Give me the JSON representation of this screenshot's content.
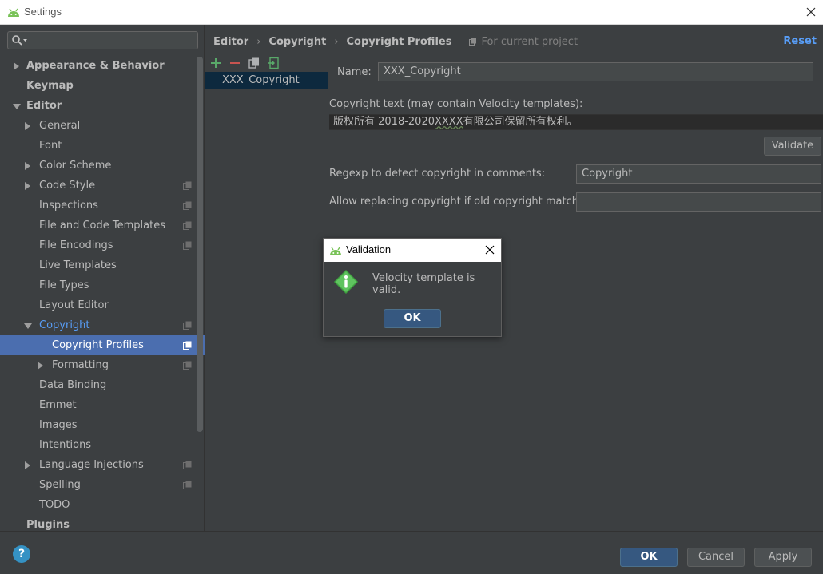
{
  "window": {
    "title": "Settings"
  },
  "sidebar": {
    "search_placeholder": "",
    "items": [
      {
        "label": "Appearance & Behavior",
        "indent": 0,
        "arrow": "right",
        "bold": true,
        "proj": false
      },
      {
        "label": "Keymap",
        "indent": 0,
        "arrow": "none",
        "bold": true,
        "proj": false
      },
      {
        "label": "Editor",
        "indent": 0,
        "arrow": "down",
        "bold": true,
        "proj": false
      },
      {
        "label": "General",
        "indent": 1,
        "arrow": "right",
        "bold": false,
        "proj": false
      },
      {
        "label": "Font",
        "indent": 1,
        "arrow": "none",
        "bold": false,
        "proj": false
      },
      {
        "label": "Color Scheme",
        "indent": 1,
        "arrow": "right",
        "bold": false,
        "proj": false
      },
      {
        "label": "Code Style",
        "indent": 1,
        "arrow": "right",
        "bold": false,
        "proj": true
      },
      {
        "label": "Inspections",
        "indent": 1,
        "arrow": "none",
        "bold": false,
        "proj": true
      },
      {
        "label": "File and Code Templates",
        "indent": 1,
        "arrow": "none",
        "bold": false,
        "proj": true
      },
      {
        "label": "File Encodings",
        "indent": 1,
        "arrow": "none",
        "bold": false,
        "proj": true
      },
      {
        "label": "Live Templates",
        "indent": 1,
        "arrow": "none",
        "bold": false,
        "proj": false
      },
      {
        "label": "File Types",
        "indent": 1,
        "arrow": "none",
        "bold": false,
        "proj": false
      },
      {
        "label": "Layout Editor",
        "indent": 1,
        "arrow": "none",
        "bold": false,
        "proj": false
      },
      {
        "label": "Copyright",
        "indent": 1,
        "arrow": "down",
        "bold": false,
        "proj": true,
        "active": true
      },
      {
        "label": "Copyright Profiles",
        "indent": 2,
        "arrow": "none",
        "bold": false,
        "proj": true,
        "selected": true
      },
      {
        "label": "Formatting",
        "indent": 2,
        "arrow": "right",
        "bold": false,
        "proj": true
      },
      {
        "label": "Data Binding",
        "indent": 1,
        "arrow": "none",
        "bold": false,
        "proj": false
      },
      {
        "label": "Emmet",
        "indent": 1,
        "arrow": "none",
        "bold": false,
        "proj": false
      },
      {
        "label": "Images",
        "indent": 1,
        "arrow": "none",
        "bold": false,
        "proj": false
      },
      {
        "label": "Intentions",
        "indent": 1,
        "arrow": "none",
        "bold": false,
        "proj": false
      },
      {
        "label": "Language Injections",
        "indent": 1,
        "arrow": "right",
        "bold": false,
        "proj": true
      },
      {
        "label": "Spelling",
        "indent": 1,
        "arrow": "none",
        "bold": false,
        "proj": true
      },
      {
        "label": "TODO",
        "indent": 1,
        "arrow": "none",
        "bold": false,
        "proj": false
      },
      {
        "label": "Plugins",
        "indent": 0,
        "arrow": "none",
        "bold": true,
        "proj": false
      }
    ]
  },
  "breadcrumb": {
    "items": [
      "Editor",
      "Copyright",
      "Copyright Profiles"
    ],
    "separator": "›",
    "scope": "For current project"
  },
  "reset_label": "Reset",
  "profiles": {
    "items": [
      "XXX_Copyright"
    ]
  },
  "form": {
    "name_label": "Name:",
    "name_value": "XXX_Copyright",
    "copyright_text_label": "Copyright text (may contain Velocity templates):",
    "copyright_text_before": "版权所有 2018-2020",
    "copyright_text_squiggle": "XXXX",
    "copyright_text_after": "有限公司保留所有权利。",
    "validate_label": "Validate",
    "regexp_label": "Regexp to detect copyright in comments:",
    "regexp_value": "Copyright",
    "allow_replace_label": "Allow replacing copyright if old copyright matches:",
    "allow_replace_value": ""
  },
  "dialog": {
    "title": "Validation",
    "message": "Velocity template is valid.",
    "ok_label": "OK"
  },
  "buttons": {
    "help": "?",
    "ok": "OK",
    "cancel": "Cancel",
    "apply": "Apply"
  },
  "colors": {
    "background": "#3c3f41",
    "selection": "#4b6eaf",
    "link": "#589df6",
    "add": "#59a869",
    "remove": "#c75450",
    "primary_button": "#365880"
  }
}
